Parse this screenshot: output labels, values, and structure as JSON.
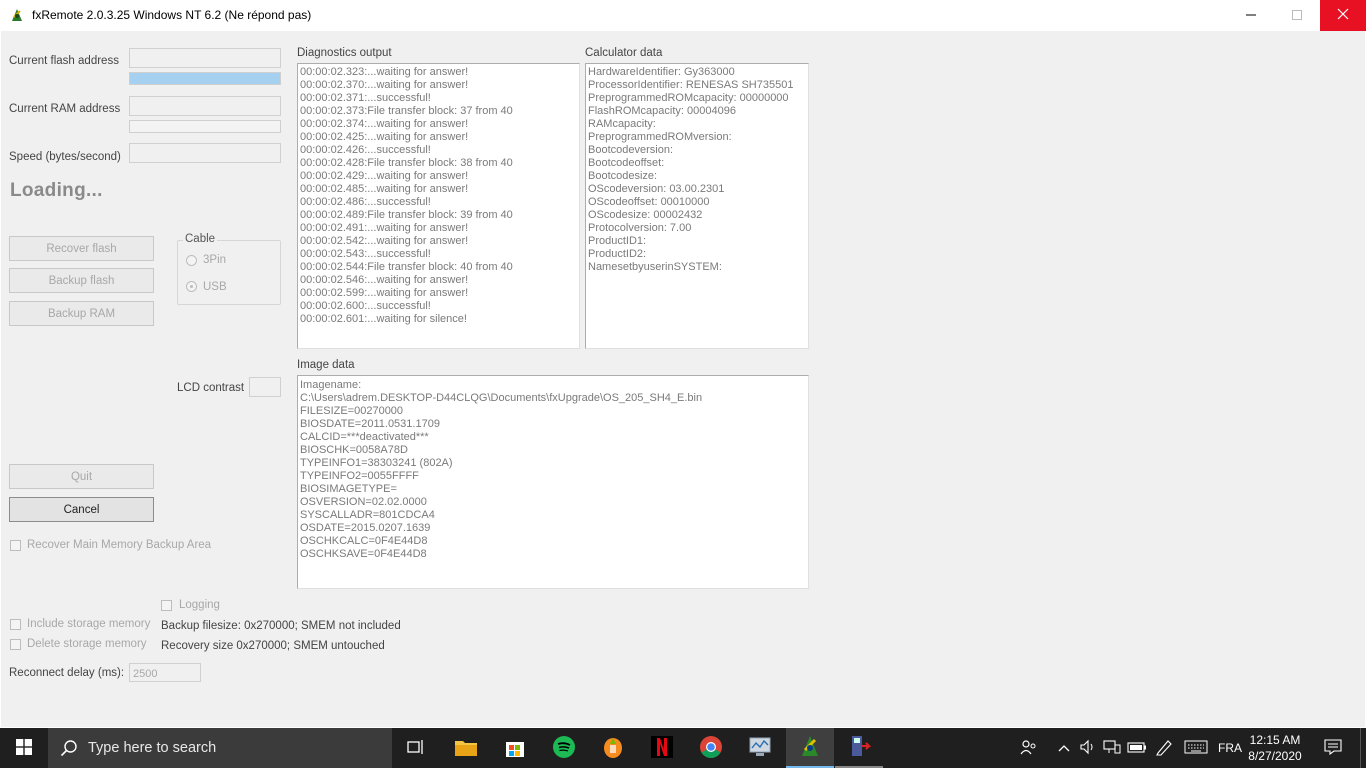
{
  "window": {
    "title": "fxRemote 2.0.3.25 Windows NT 6.2 (Ne répond pas)",
    "close_color": "#e81123"
  },
  "left": {
    "flash_label": "Current flash address",
    "ram_label": "Current RAM address",
    "speed_label": "Speed (bytes/second)",
    "flash_progress": 1.0,
    "status": "Loading...",
    "recover_flash": "Recover flash",
    "backup_flash": "Backup flash",
    "backup_ram": "Backup RAM",
    "cable_legend": "Cable",
    "cable_3pin": "3Pin",
    "cable_usb": "USB",
    "lcd_label": "LCD contrast",
    "quit": "Quit",
    "cancel": "Cancel",
    "recover_main": "Recover Main Memory Backup Area",
    "logging": "Logging",
    "include_storage": "Include storage memory",
    "delete_storage": "Delete storage memory",
    "backup_filesize": "Backup filesize: 0x270000; SMEM not included",
    "recovery_size": "Recovery size 0x270000; SMEM untouched",
    "reconnect_label": "Reconnect delay (ms):",
    "reconnect_value": "2500"
  },
  "diagnostics": {
    "label": "Diagnostics output",
    "lines": [
      "00:00:02.323:...waiting for answer!",
      "00:00:02.370:...waiting for answer!",
      "00:00:02.371:...successful!",
      "00:00:02.373:File transfer block: 37 from 40",
      "00:00:02.374:...waiting for answer!",
      "00:00:02.425:...waiting for answer!",
      "00:00:02.426:...successful!",
      "00:00:02.428:File transfer block: 38 from 40",
      "00:00:02.429:...waiting for answer!",
      "00:00:02.485:...waiting for answer!",
      "00:00:02.486:...successful!",
      "00:00:02.489:File transfer block: 39 from 40",
      "00:00:02.491:...waiting for answer!",
      "00:00:02.542:...waiting for answer!",
      "00:00:02.543:...successful!",
      "00:00:02.544:File transfer block: 40 from 40",
      "00:00:02.546:...waiting for answer!",
      "00:00:02.599:...waiting for answer!",
      "00:00:02.600:...successful!",
      "00:00:02.601:...waiting for silence!"
    ]
  },
  "calculator": {
    "label": "Calculator data",
    "lines": [
      "HardwareIdentifier: Gy363000",
      "ProcessorIdentifier: RENESAS SH735501",
      "PreprogrammedROMcapacity: 00000000",
      "FlashROMcapacity: 00004096",
      "RAMcapacity:",
      "PreprogrammedROMversion:",
      "Bootcodeversion:",
      "Bootcodeoffset:",
      "Bootcodesize:",
      "OScodeversion: 03.00.2301",
      "OScodeoffset: 00010000",
      "OScodesize: 00002432",
      "Protocolversion: 7.00",
      "ProductID1:",
      "ProductID2:",
      "NamesetbyuserinSYSTEM:"
    ]
  },
  "image": {
    "label": "Image data",
    "lines": [
      "Imagename:",
      "C:\\Users\\adrem.DESKTOP-D44CLQG\\Documents\\fxUpgrade\\OS_205_SH4_E.bin",
      "FILESIZE=00270000",
      "BIOSDATE=2011.0531.1709",
      "CALCID=***deactivated***",
      "BIOSCHK=0058A78D",
      "TYPEINFO1=38303241 (802A)",
      "TYPEINFO2=0055FFFF",
      "BIOSIMAGETYPE=",
      "OSVERSION=02.02.0000",
      "SYSCALLADR=801CDCA4",
      "OSDATE=2015.0207.1639",
      "OSCHKCALC=0F4E44D8",
      "OSCHKSAVE=0F4E44D8"
    ]
  },
  "taskbar": {
    "search_placeholder": "Type here to search",
    "language": "FRA",
    "time": "12:15 AM",
    "date": "8/27/2020",
    "accent_color": "#76b9ed"
  }
}
